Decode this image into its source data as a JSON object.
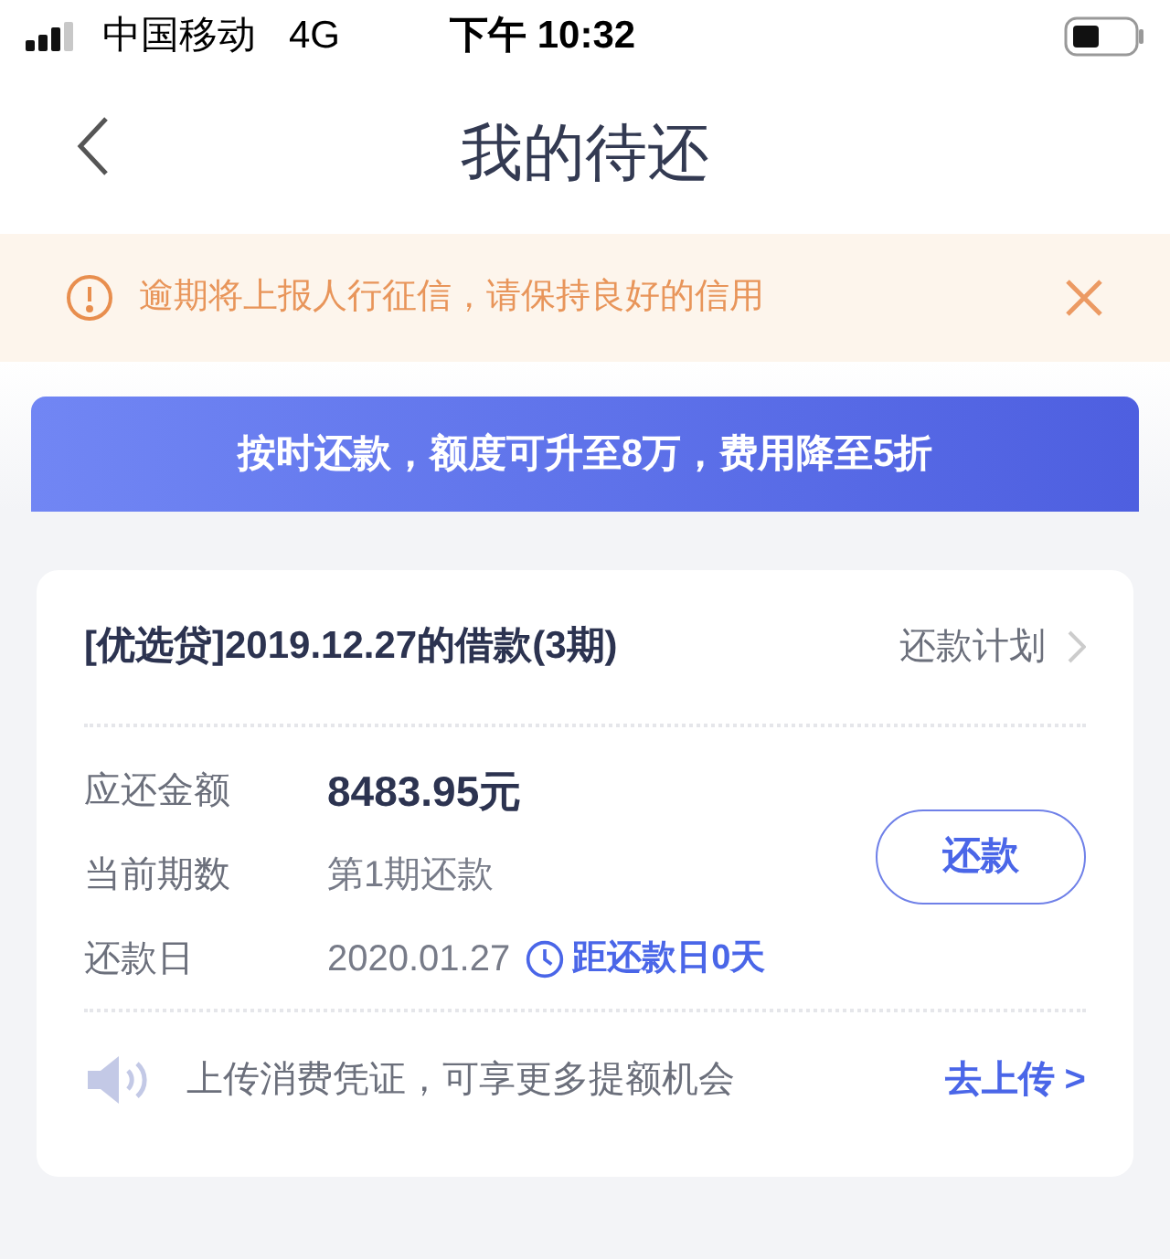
{
  "status_bar": {
    "carrier": "中国移动",
    "network": "4G",
    "time": "下午 10:32"
  },
  "header": {
    "title": "我的待还"
  },
  "notice": {
    "text": "逾期将上报人行征信，请保持良好的信用"
  },
  "promo": {
    "text": "按时还款，额度可升至8万，费用降至5折"
  },
  "loan": {
    "title": "[优选贷]2019.12.27的借款(3期)",
    "plan_link": "还款计划",
    "rows": [
      {
        "kind": "amount",
        "label": "应还金额",
        "value": "8483.95元"
      },
      {
        "kind": "plain",
        "label": "当前期数",
        "value": "第1期还款"
      },
      {
        "kind": "date",
        "label": "还款日",
        "value": "2020.01.27",
        "hint": "距还款日0天"
      }
    ],
    "pay_button": "还款",
    "tip": {
      "text": "上传消费凭证，可享更多提额机会",
      "link": "去上传 >"
    }
  }
}
